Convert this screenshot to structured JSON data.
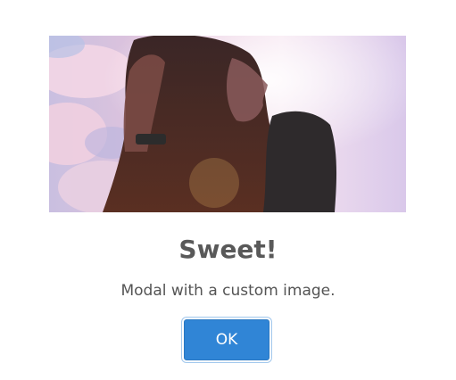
{
  "modal": {
    "title": "Sweet!",
    "text": "Modal with a custom image.",
    "confirm_label": "OK",
    "image_alt": "Custom image: woman with long hair against a pink sunlit sky"
  },
  "colors": {
    "title": "#595959",
    "text": "#545454",
    "button_bg": "#3085d6",
    "background": "#ffffff"
  }
}
